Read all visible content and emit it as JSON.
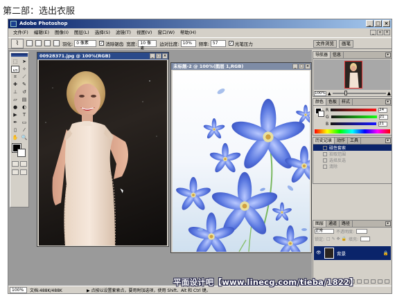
{
  "page": {
    "heading": "第二部：选出衣服"
  },
  "app": {
    "title": "Adobe Photoshop",
    "menu": [
      "文件(F)",
      "编辑(E)",
      "图像(I)",
      "图层(L)",
      "选择(S)",
      "滤镜(T)",
      "视图(V)",
      "窗口(W)",
      "帮助(H)"
    ]
  },
  "options": {
    "feather_label": "羽化:",
    "feather_value": "0 像素",
    "antialias_label": "消除锯齿",
    "width_label": "宽度:",
    "width_value": "10 像素",
    "edge_contrast_label": "边对比度:",
    "edge_contrast_value": "10%",
    "frequency_label": "频率:",
    "frequency_value": "57",
    "pen_pressure_label": "光笔压力",
    "tab_file_browser": "文件浏览",
    "tab_brushes": "画笔"
  },
  "doc1": {
    "title": "00928371.jpg @ 100%(RGB)"
  },
  "doc2": {
    "title": "未标题-2 @ 100%(图层 1,RGB)"
  },
  "navigator": {
    "tabs": [
      "导航器",
      "信息"
    ],
    "zoom": "100%"
  },
  "color": {
    "tabs": [
      "颜色",
      "色板",
      "样式"
    ],
    "channels": [
      {
        "label": "R",
        "value": "24"
      },
      {
        "label": "G",
        "value": "21"
      },
      {
        "label": "B",
        "value": "21"
      }
    ]
  },
  "history": {
    "tabs": [
      "历史记录",
      "动作",
      "工具"
    ],
    "items": [
      "磁性套索",
      "拾取范围",
      "选择反选",
      "清除"
    ]
  },
  "layers": {
    "tabs": [
      "图层",
      "通道",
      "路径"
    ],
    "blend_mode": "正常",
    "opacity_label": "不透明度:",
    "lock_label": "锁定:",
    "fill_label": "填充:",
    "layer_name": "背景"
  },
  "status": {
    "zoom": "100%",
    "doc_size": "文档:488K/488K",
    "hint": "▶ 点按以设置套索点，要用附加选项，使用 Shift、Alt 和 Ctrl 键。"
  },
  "watermark": "平面设计吧【www.linecg.com/tieba/1822】"
}
